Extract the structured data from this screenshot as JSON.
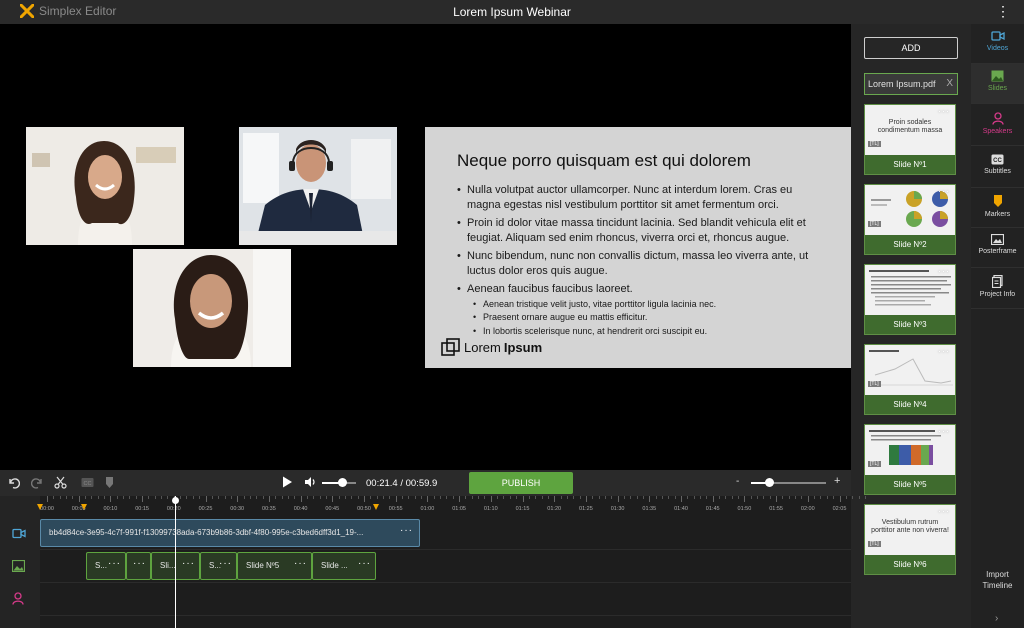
{
  "topbar": {
    "brand": "Simplex Editor",
    "title": "Lorem Ipsum Webinar"
  },
  "slide": {
    "title": "Neque porro quisquam est qui dolorem",
    "bullets": [
      "Nulla volutpat auctor ullamcorper. Nunc at interdum lorem. Cras eu magna egestas nisl vestibulum porttitor sit amet fermentum orci.",
      "Proin id dolor vitae massa tincidunt lacinia. Sed blandit vehicula elit et feugiat. Aliquam sed enim rhoncus, viverra orci et, rhoncus augue.",
      "Nunc bibendum, nunc non convallis dictum, massa leo viverra ante, ut luctus dolor eros quis augue.",
      "Aenean faucibus faucibus laoreet."
    ],
    "subbullets": [
      "Aenean tristique velit justo, vitae porttitor ligula lacinia nec.",
      "Praesent ornare augue eu mattis efficitur.",
      "In lobortis scelerisque nunc, at hendrerit orci suscipit eu."
    ],
    "logo_light": "Lorem",
    "logo_bold": "Ipsum"
  },
  "panel": {
    "add_label": "ADD",
    "file_name": "Lorem Ipsum.pdf",
    "file_close": "X",
    "thumbnails": [
      {
        "caption": "Slide Nº1",
        "text": "Proin sodales condimentum massa"
      },
      {
        "caption": "Slide Nº2",
        "text": ""
      },
      {
        "caption": "Slide Nº3",
        "text": ""
      },
      {
        "caption": "Slide Nº4",
        "text": ""
      },
      {
        "caption": "Slide Nº5",
        "text": ""
      },
      {
        "caption": "Slide Nº6",
        "text": "Vestibulum rutrum porttitor ante non viverra!"
      }
    ],
    "thumb_dots": "···",
    "thumb_tag": "[TL]"
  },
  "sidebar": {
    "items": [
      {
        "label": "Videos",
        "icon": "video-icon",
        "color": "#4fa6d6"
      },
      {
        "label": "Slides",
        "icon": "image-icon",
        "color": "#6aa84f"
      },
      {
        "label": "Speakers",
        "icon": "person-icon",
        "color": "#d63a8a"
      },
      {
        "label": "Subtitles",
        "icon": "cc-icon",
        "color": "#dddddd"
      },
      {
        "label": "Markers",
        "icon": "marker-icon",
        "color": "#f0a500"
      },
      {
        "label": "Posterframe",
        "icon": "posterframe-icon",
        "color": "#dddddd"
      },
      {
        "label": "Project Info",
        "icon": "info-icon",
        "color": "#dddddd"
      }
    ],
    "import_label_1": "Import",
    "import_label_2": "Timeline",
    "expand": "›"
  },
  "controls": {
    "time": "00:21.4 / 00:59.9",
    "publish_label": "PUBLISH",
    "volume_level": 0.6,
    "zoom_level": 0.24,
    "zoom_minus": "-",
    "zoom_plus": "+"
  },
  "timeline": {
    "ticks": [
      "00:00",
      "00:05",
      "00:10",
      "00:15",
      "00:20",
      "00:25",
      "00:30",
      "00:35",
      "00:40",
      "00:45",
      "00:50",
      "00:55",
      "01:00",
      "01:05",
      "01:10",
      "01:15",
      "01:20",
      "01:25",
      "01:30",
      "01:35",
      "01:40",
      "01:45",
      "01:50",
      "01:55",
      "02:00",
      "02:05"
    ],
    "video_clip": "bb4d84ce-3e95-4c7f-991f-f13099738ada-673b9b86-3dbf-4f80-995e-c3bed6dff3d1_19-...",
    "slide_clips": [
      "S...",
      "",
      "Sli...",
      "S...",
      "Slide Nº5",
      "Slide ..."
    ],
    "clip_dots": "···"
  },
  "colors": {
    "accent_green": "#5ea43f",
    "video_blue": "#4fa6d6",
    "speaker_pink": "#d63a8a",
    "marker_orange": "#f0a500"
  }
}
